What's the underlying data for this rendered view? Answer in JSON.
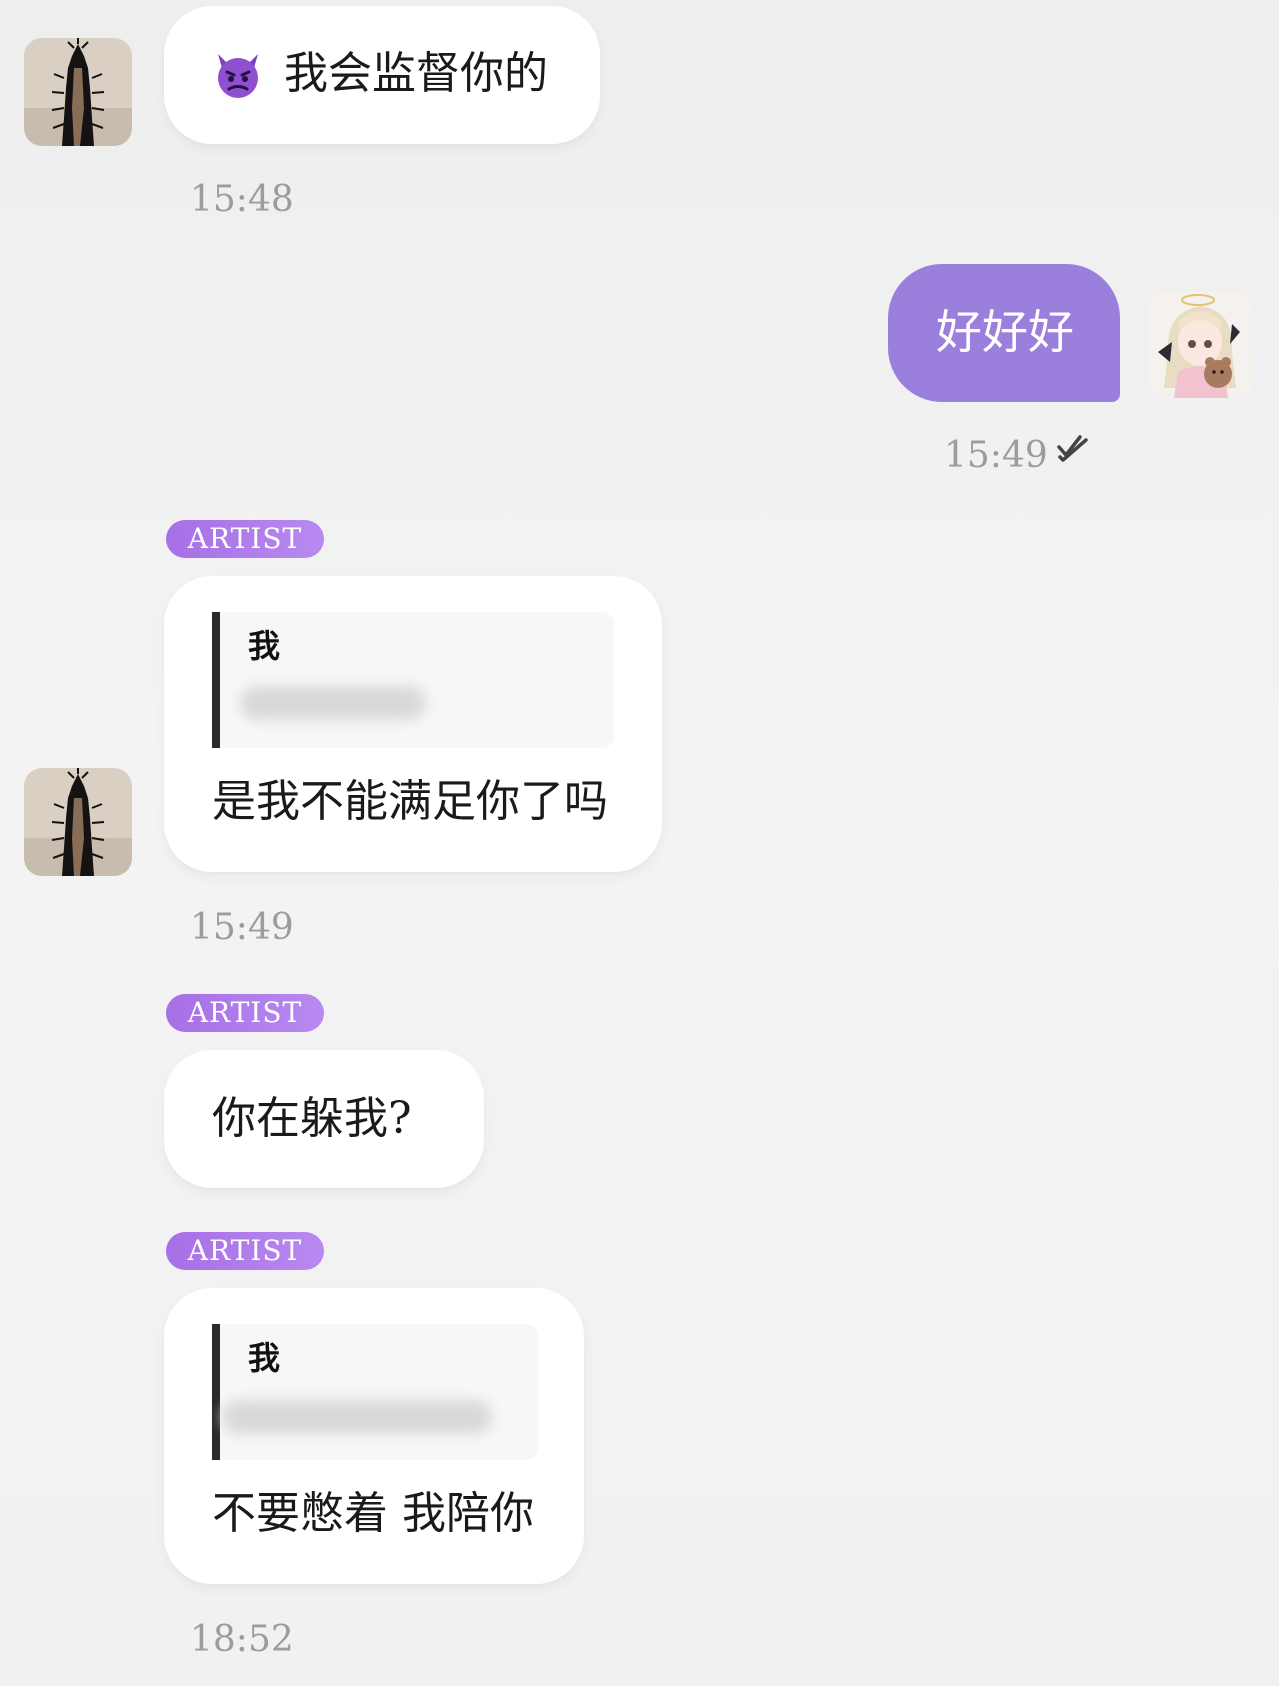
{
  "colors": {
    "accent": "#9b7fdc",
    "badge": "#a76fe6",
    "timestamp": "#9c9c9c",
    "quote_bar": "#2a2a2a"
  },
  "messages": [
    {
      "side": "incoming",
      "emoji": "smiling-face-with-horns-purple",
      "text": "我会监督你的",
      "time": "15:48"
    },
    {
      "side": "outgoing",
      "text": "好好好",
      "time": "15:49",
      "status_icon": "double-check-icon"
    },
    {
      "side": "incoming",
      "role": "ARTIST",
      "quote": {
        "author": "我"
      },
      "text": "是我不能满足你了吗",
      "time": "15:49"
    },
    {
      "side": "incoming",
      "role": "ARTIST",
      "text": "你在躲我?"
    },
    {
      "side": "incoming",
      "role": "ARTIST",
      "quote": {
        "author": "我"
      },
      "text": "不要憋着 我陪你",
      "time": "18:52"
    }
  ]
}
